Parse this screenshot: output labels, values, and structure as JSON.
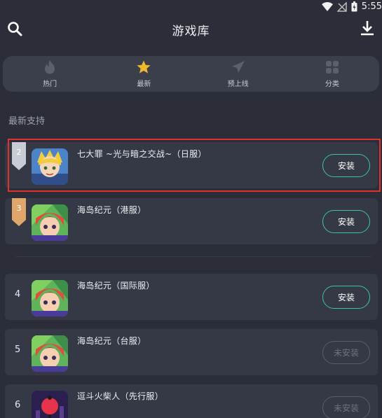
{
  "status": {
    "time": "5:55"
  },
  "header": {
    "title": "游戏库"
  },
  "tabs": [
    {
      "label": "热门",
      "icon": "fire-icon"
    },
    {
      "label": "最新",
      "icon": "star-icon"
    },
    {
      "label": "预上线",
      "icon": "paper-plane-icon"
    },
    {
      "label": "分类",
      "icon": "grid-icon"
    }
  ],
  "section_title": "最新支持",
  "games": [
    {
      "rank": "2",
      "name": "七大罪 ~光与暗之交战~（日服）",
      "button": "安装"
    },
    {
      "rank": "3",
      "name": "海岛纪元（港服）",
      "button": "安装"
    },
    {
      "rank": "4",
      "name": "海岛纪元（国际服）",
      "button": "安装"
    },
    {
      "rank": "5",
      "name": "海岛纪元（台服）",
      "button": "未安装"
    },
    {
      "rank": "6",
      "name": "逗斗火柴人（先行服）",
      "button": "未安装"
    }
  ],
  "colors": {
    "accent": "#3ec3a6",
    "active_tab": "#f0b72f",
    "highlight": "#e0312c"
  }
}
